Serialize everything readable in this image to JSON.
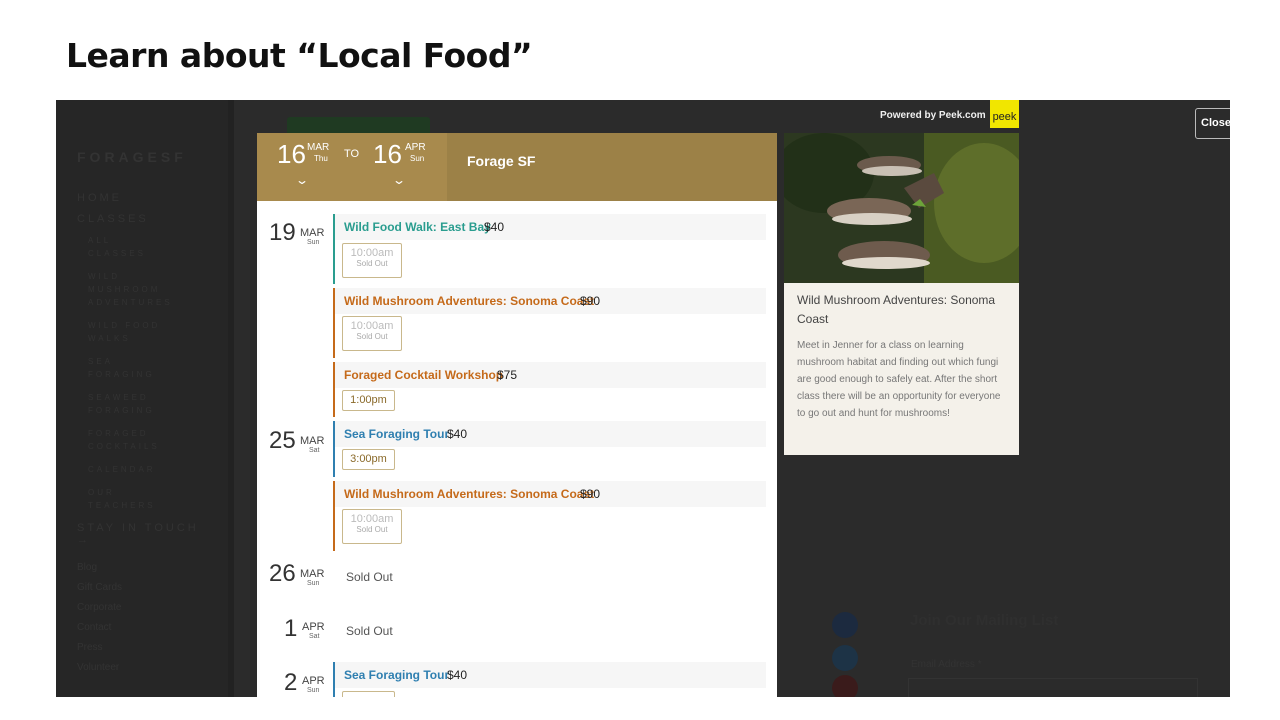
{
  "slide_title": "Learn about “Local Food”",
  "background_site": {
    "logo": "FORAGESF",
    "nav": [
      {
        "label": "HOME",
        "sub": false
      },
      {
        "label": "CLASSES",
        "sub": false
      },
      {
        "label": "ALL CLASSES",
        "sub": true
      },
      {
        "label": "WILD MUSHROOM ADVENTURES",
        "sub": true
      },
      {
        "label": "WILD FOOD WALKS",
        "sub": true
      },
      {
        "label": "SEA FORAGING",
        "sub": true
      },
      {
        "label": "SEAWEED FORAGING",
        "sub": true
      },
      {
        "label": "FORAGED COCKTAILS",
        "sub": true
      },
      {
        "label": "CALENDAR",
        "sub": true
      },
      {
        "label": "OUR TEACHERS",
        "sub": true
      },
      {
        "label": "STAY IN TOUCH →",
        "sub": false
      }
    ],
    "footer_links": [
      "Blog",
      "Gift Cards",
      "Corporate",
      "Contact",
      "Press",
      "Volunteer"
    ],
    "mailing_title": "Join Our Mailing List",
    "email_label": "Email Address *"
  },
  "widget": {
    "powered_by": "Powered by Peek.com",
    "peek_logo": "peek",
    "close_label": "Close",
    "range": {
      "from": {
        "day": "16",
        "month": "MAR",
        "dow": "Thu"
      },
      "to_label": "TO",
      "to": {
        "day": "16",
        "month": "APR",
        "dow": "Sun"
      }
    },
    "business_name": "Forage SF",
    "days": [
      {
        "day": "19",
        "month": "MAR",
        "dow": "Sun"
      },
      {
        "day": "25",
        "month": "MAR",
        "dow": "Sat"
      },
      {
        "day": "26",
        "month": "MAR",
        "dow": "Sun",
        "status": "Sold Out"
      },
      {
        "day": "1",
        "month": "APR",
        "dow": "Sat",
        "status": "Sold Out"
      },
      {
        "day": "2",
        "month": "APR",
        "dow": "Sun"
      }
    ],
    "events": [
      {
        "name": "Wild Food Walk: East Bay",
        "price": "$40",
        "color": "#2a9d8f",
        "time": "10:00am",
        "note": "Sold Out"
      },
      {
        "name": "Wild Mushroom Adventures: Sonoma Coast",
        "price": "$90",
        "color": "#c56a1a",
        "time": "10:00am",
        "note": "Sold Out"
      },
      {
        "name": "Foraged Cocktail Workshop",
        "price": "$75",
        "color": "#c56a1a",
        "time": "1:00pm",
        "note": ""
      },
      {
        "name": "Sea Foraging Tour",
        "price": "$40",
        "color": "#2f7fb0",
        "time": "3:00pm",
        "note": ""
      },
      {
        "name": "Wild Mushroom Adventures: Sonoma Coast",
        "price": "$90",
        "color": "#c56a1a",
        "time": "10:00am",
        "note": "Sold Out"
      },
      {
        "name": "Sea Foraging Tour",
        "price": "$40",
        "color": "#2f7fb0",
        "time": "",
        "note": ""
      }
    ],
    "detail": {
      "title": "Wild Mushroom Adventures: Sonoma Coast",
      "description": "Meet in Jenner for a class on learning mushroom habitat and finding out which fungi are good enough to safely eat. After the short class there will be an opportunity for everyone to go out and hunt for mushrooms!"
    }
  }
}
